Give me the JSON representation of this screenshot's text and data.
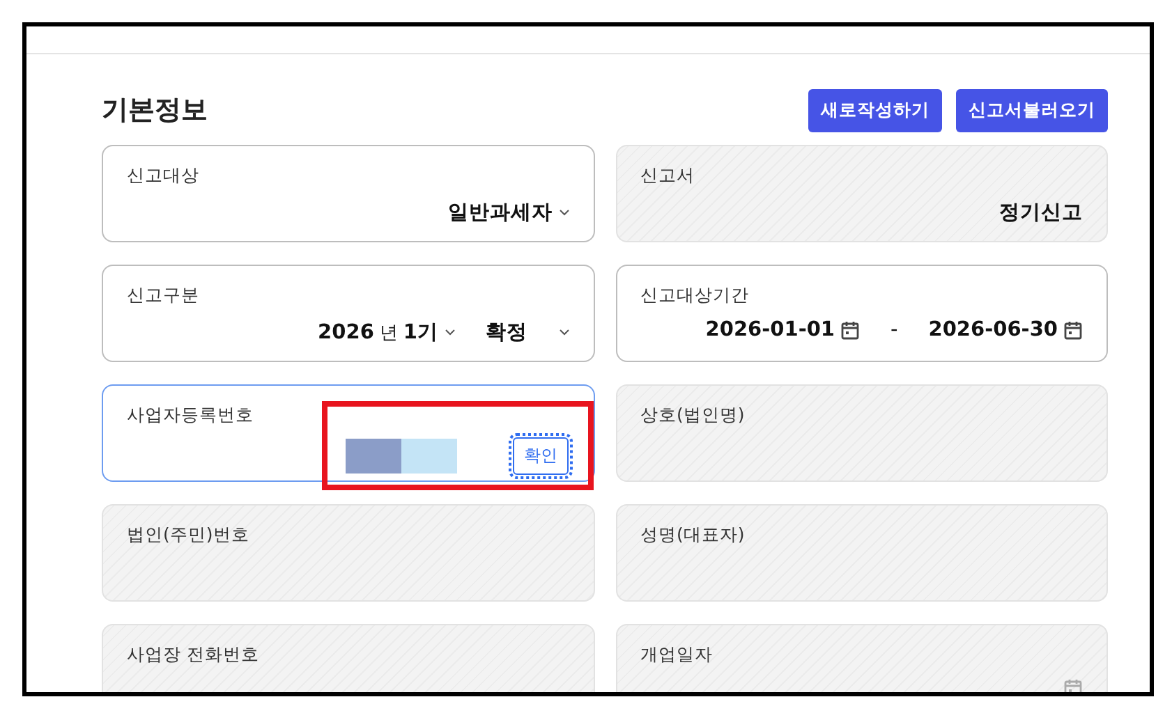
{
  "section": {
    "title": "기본정보",
    "buttons": [
      "새로작성하기",
      "신고서불러오기"
    ]
  },
  "fields": [
    {
      "kind": "select",
      "label": "신고대상",
      "value": "일반과세자",
      "disabled": false
    },
    {
      "kind": "text",
      "label": "신고서",
      "value": "정기신고",
      "disabled": true
    },
    {
      "kind": "period",
      "label": "신고구분",
      "year": "2026",
      "year_unit": "년",
      "term": "1기",
      "status": "확정",
      "disabled": false
    },
    {
      "kind": "date-range",
      "label": "신고대상기간",
      "start": "2026-01-01",
      "separator": "-",
      "end": "2026-06-30",
      "disabled": false
    },
    {
      "kind": "business-number",
      "label": "사업자등록번호",
      "button": "확인",
      "focused": true,
      "highlighted": true,
      "disabled": false
    },
    {
      "kind": "text",
      "label": "상호(법인명)",
      "disabled": true
    },
    {
      "kind": "text",
      "label": "법인(주민)번호",
      "disabled": true
    },
    {
      "kind": "text",
      "label": "성명(대표자)",
      "disabled": true
    },
    {
      "kind": "text",
      "label": "사업장 전화번호",
      "disabled": true
    },
    {
      "kind": "date",
      "label": "개업일자",
      "disabled": true
    }
  ]
}
